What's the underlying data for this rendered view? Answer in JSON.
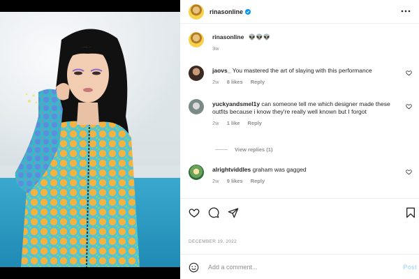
{
  "header": {
    "username": "rinasonline"
  },
  "caption": {
    "username": "rinasonline",
    "text": "👽👽👽",
    "time": "3w"
  },
  "comments": [
    {
      "username": "jaovs_",
      "text": "You mastered the art of slaying with this performance",
      "time": "2w",
      "likes": "8 likes",
      "reply": "Reply"
    },
    {
      "username": "yuckyandsmel1y",
      "text": "can someone tell me which designer made these outfits because i know they're really well known but I forgot",
      "time": "2w",
      "likes": "1 like",
      "reply": "Reply"
    },
    {
      "username": "alrightviddles",
      "text": "graham was gagged",
      "time": "2w",
      "likes": "9 likes",
      "reply": "Reply"
    }
  ],
  "view_replies": "View replies (1)",
  "date": "DECEMBER 19, 2022",
  "add_comment": {
    "placeholder": "Add a comment...",
    "post_label": "Post"
  },
  "colors": {
    "verified": "#0095f6",
    "post_disabled": "#b2dffc",
    "bench": "#2a9fc7"
  },
  "icons": [
    "verified-badge-icon",
    "more-options-icon",
    "heart-icon",
    "comment-icon",
    "share-icon",
    "bookmark-icon",
    "emoji-icon"
  ]
}
